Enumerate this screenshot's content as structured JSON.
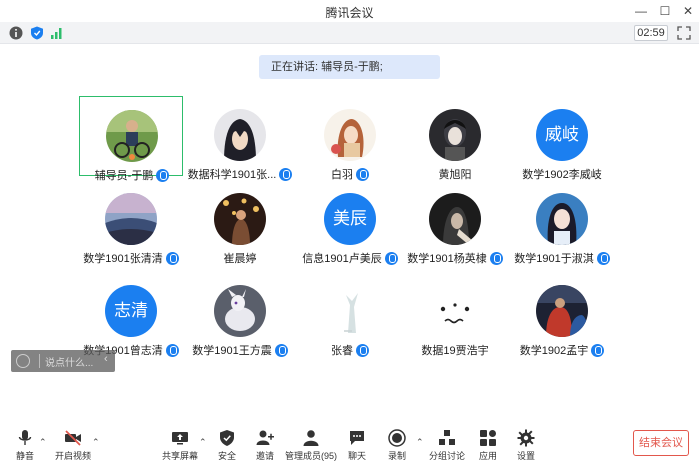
{
  "window": {
    "title": "腾讯会议"
  },
  "status": {
    "timer": "02:59"
  },
  "speaking": {
    "text": "正在讲话: 辅导员-于鹏;"
  },
  "participants": [
    {
      "name": "辅导员-于鹏",
      "avatar_type": "photo",
      "muted": false,
      "active": true
    },
    {
      "name": "数据科学1901张...",
      "avatar_type": "photo",
      "muted": true
    },
    {
      "name": "白羽",
      "avatar_type": "photo",
      "muted": true
    },
    {
      "name": "黄旭阳",
      "avatar_type": "photo",
      "muted": false
    },
    {
      "name": "数学1902李威岐",
      "avatar_type": "text",
      "avatar_text": "威岐",
      "muted": false
    },
    {
      "name": "数学1901张清清",
      "avatar_type": "photo",
      "muted": true
    },
    {
      "name": "崔晨婷",
      "avatar_type": "photo",
      "muted": false
    },
    {
      "name": "信息1901卢美辰",
      "avatar_type": "text",
      "avatar_text": "美辰",
      "muted": true
    },
    {
      "name": "数学1901杨英棣",
      "avatar_type": "photo",
      "muted": true
    },
    {
      "name": "数学1901于淑淇",
      "avatar_type": "photo",
      "muted": true
    },
    {
      "name": "数学1901曾志清",
      "avatar_type": "text",
      "avatar_text": "志清",
      "muted": true
    },
    {
      "name": "数学1901王方震",
      "avatar_type": "photo",
      "muted": true
    },
    {
      "name": "张睿",
      "avatar_type": "photo",
      "muted": true
    },
    {
      "name": "数据19贾浩宇",
      "avatar_type": "face",
      "muted": false
    },
    {
      "name": "数学1902孟宇",
      "avatar_type": "photo",
      "muted": true
    }
  ],
  "chat": {
    "placeholder": "说点什么..."
  },
  "toolbar": {
    "mute": "静音",
    "video": "开启视频",
    "share": "共享屏幕",
    "security": "安全",
    "invite": "邀请",
    "members": "管理成员(95)",
    "chat": "聊天",
    "record": "录制",
    "breakout": "分组讨论",
    "apps": "应用",
    "settings": "设置",
    "end": "结束会议"
  },
  "colors": {
    "accent": "#1b7ff0",
    "active_border": "#2dbd6b",
    "end_red": "#e2574c",
    "speaking_bg": "#dde8fb"
  }
}
